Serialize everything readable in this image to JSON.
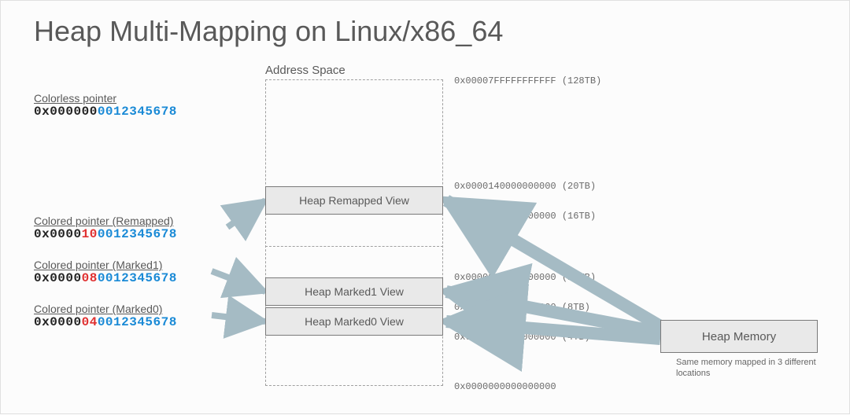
{
  "title": "Heap Multi-Mapping on Linux/x86_64",
  "address_space_label": "Address Space",
  "heap_memory_label": "Heap Memory",
  "mapping_note": "Same memory mapped in 3 different locations",
  "views": {
    "remapped": "Heap Remapped View",
    "marked1": "Heap Marked1 View",
    "marked0": "Heap Marked0 View"
  },
  "address_markers": {
    "top": {
      "addr": "0x00007FFFFFFFFFFF",
      "size": "(128TB)"
    },
    "a20": {
      "addr": "0x0000140000000000",
      "size": "(20TB)"
    },
    "a16": {
      "addr": "0x0000100000000000",
      "size": "(16TB)"
    },
    "a12": {
      "addr": "0x00000C0000000000",
      "size": "(12TB)"
    },
    "a8": {
      "addr": "0x0000080000000000",
      "size": "(8TB)"
    },
    "a4": {
      "addr": "0x0000040000000000",
      "size": "(4TB)"
    },
    "bottom": {
      "addr": "0x0000000000000000",
      "size": ""
    }
  },
  "pointers": {
    "colorless": {
      "label": "Colorless pointer",
      "prefix": "0x000000",
      "color": "0",
      "suffix": "012345678"
    },
    "remapped": {
      "label": "Colored pointer (Remapped)",
      "prefix": "0x0000",
      "color": "10",
      "suffix": "0012345678"
    },
    "marked1": {
      "label": "Colored pointer (Marked1)",
      "prefix": "0x0000",
      "color": "08",
      "suffix": "0012345678"
    },
    "marked0": {
      "label": "Colored pointer (Marked0)",
      "prefix": "0x0000",
      "color": "04",
      "suffix": "0012345678"
    }
  }
}
